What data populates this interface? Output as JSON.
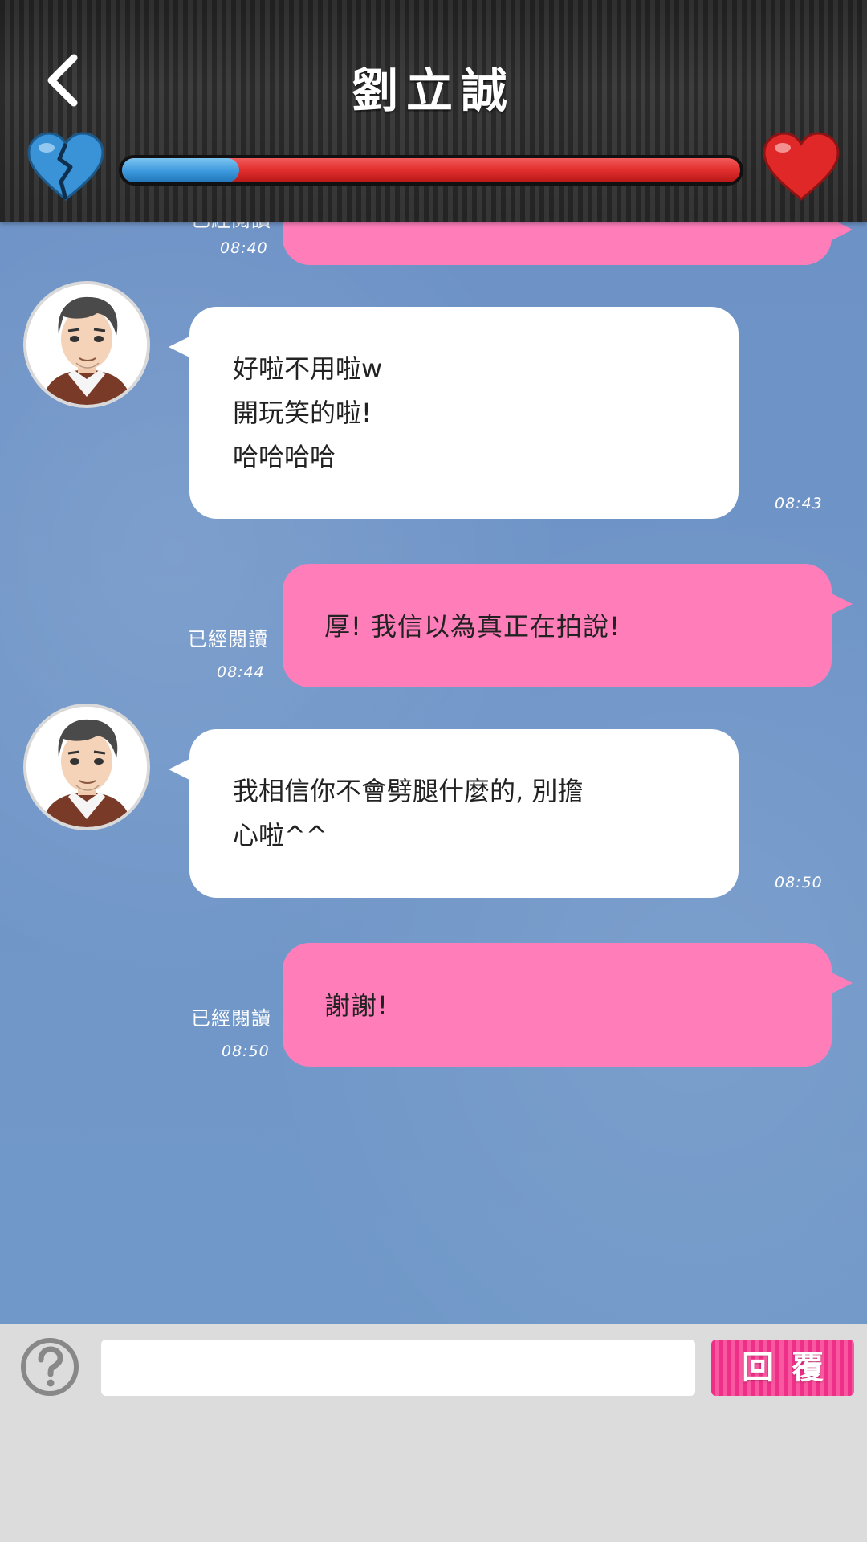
{
  "header": {
    "title": "劉立誠",
    "back_icon": "chevron-left-icon",
    "left_icon": "broken-heart-icon",
    "right_icon": "heart-icon",
    "affection_meter": 0.19,
    "colors": {
      "meter_blue": "#3b98dc",
      "meter_red": "#e22e2e",
      "heart_blue": "#3a93d6",
      "heart_red": "#e02828"
    }
  },
  "chat": {
    "partial_top": {
      "read_label": "已經閱讀",
      "time": "08:40"
    },
    "messages": [
      {
        "side": "incoming",
        "text": "好啦不用啦w\n開玩笑的啦!\n哈哈哈哈",
        "time": "08:43"
      },
      {
        "side": "outgoing",
        "text": "厚! 我信以為真正在拍說!",
        "read_label": "已經閱讀",
        "time": "08:44"
      },
      {
        "side": "incoming",
        "text": "我相信你不會劈腿什麼的, 別擔\n心啦^^",
        "time": "08:50"
      },
      {
        "side": "outgoing",
        "text": "謝謝!",
        "read_label": "已經閱讀",
        "time": "08:50"
      }
    ],
    "colors": {
      "background": "#6f95c7",
      "incoming_bubble": "#ffffff",
      "outgoing_bubble": "#ff7eba"
    }
  },
  "input_bar": {
    "help_icon": "question-mark-icon",
    "input_value": "",
    "input_placeholder": "",
    "reply_label": "回覆",
    "reply_color": "#ee2f88"
  }
}
